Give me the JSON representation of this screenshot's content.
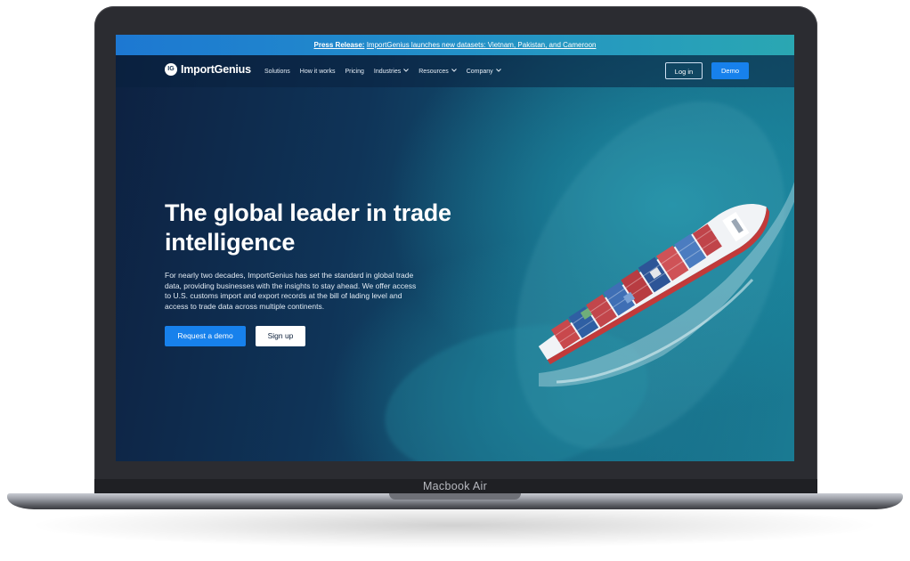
{
  "device": {
    "model_label": "Macbook Air"
  },
  "announcement": {
    "prefix": "Press Release:",
    "text": "ImportGenius launches new datasets: Vietnam, Pakistan, and Cameroon"
  },
  "brand": {
    "logo_mark": "IG",
    "name": "ImportGenius"
  },
  "nav": {
    "items": [
      {
        "label": "Solutions",
        "has_dropdown": false
      },
      {
        "label": "How it works",
        "has_dropdown": false
      },
      {
        "label": "Pricing",
        "has_dropdown": false
      },
      {
        "label": "Industries",
        "has_dropdown": true
      },
      {
        "label": "Resources",
        "has_dropdown": true
      },
      {
        "label": "Company",
        "has_dropdown": true
      }
    ],
    "login_label": "Log in",
    "demo_label": "Demo"
  },
  "hero": {
    "title_line1": "The global leader in trade",
    "title_line2": "intelligence",
    "description": "For nearly two decades, ImportGenius has set the standard in global trade data, providing businesses with the insights to stay ahead. We offer access to U.S. customs import and export records at the bill of lading level and access to trade data across multiple continents.",
    "primary_cta": "Request a demo",
    "secondary_cta": "Sign up"
  },
  "colors": {
    "accent": "#1781ec",
    "announcement_start": "#1d78d2",
    "announcement_end": "#2aa7b2",
    "hero_dark": "#0d2141",
    "sea": "#1a7b93"
  },
  "icons": {
    "dropdown": "chevron-down-icon",
    "hero_image": "container-ship-image"
  }
}
